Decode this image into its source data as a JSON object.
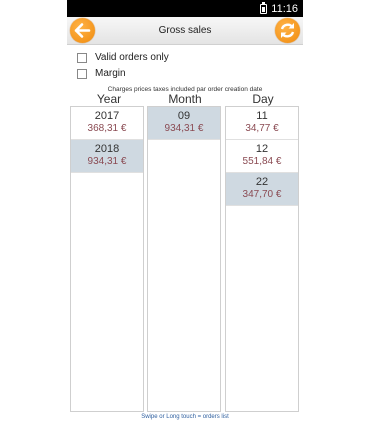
{
  "status_bar": {
    "time": "11:16"
  },
  "header": {
    "title": "Gross sales"
  },
  "options": [
    {
      "label": "Valid orders only",
      "checked": false
    },
    {
      "label": "Margin",
      "checked": false
    }
  ],
  "note": "Charges prices taxes included par order creation date",
  "columns": {
    "year": {
      "header": "Year",
      "items": [
        {
          "key": "2017",
          "value": "368,31 €",
          "selected": false
        },
        {
          "key": "2018",
          "value": "934,31 €",
          "selected": true
        }
      ]
    },
    "month": {
      "header": "Month",
      "items": [
        {
          "key": "09",
          "value": "934,31 €",
          "selected": true
        }
      ]
    },
    "day": {
      "header": "Day",
      "items": [
        {
          "key": "11",
          "value": "34,77 €",
          "selected": false
        },
        {
          "key": "12",
          "value": "551,84 €",
          "selected": false
        },
        {
          "key": "22",
          "value": "347,70 €",
          "selected": true
        }
      ]
    }
  },
  "footer": "Swipe or Long touch = orders list",
  "colors": {
    "accent": "#f08a0c",
    "selected_row": "#cfd9e1",
    "value_text": "#8a4a52"
  }
}
